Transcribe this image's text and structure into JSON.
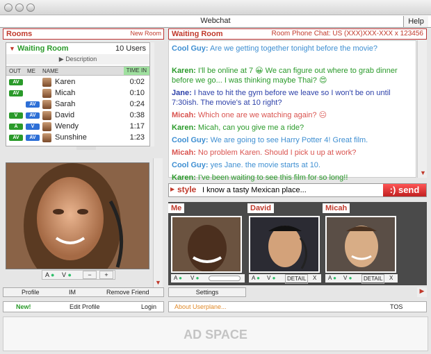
{
  "app": {
    "title": "Webchat",
    "help": "Help"
  },
  "rooms": {
    "title": "Rooms",
    "new_room": "New Room"
  },
  "waiting_room": {
    "title": "Waiting Room",
    "count": "10 Users",
    "description": "Description",
    "columns": {
      "out": "OUT",
      "me": "ME",
      "name": "NAME",
      "time": "TIME IN"
    },
    "users": [
      {
        "name": "Karen",
        "time": "0:02",
        "out": "AV",
        "me": ""
      },
      {
        "name": "Micah",
        "time": "0:10",
        "out": "AV",
        "me": ""
      },
      {
        "name": "Sarah",
        "time": "0:24",
        "out": "",
        "me": "AV"
      },
      {
        "name": "David",
        "time": "0:38",
        "out": "V",
        "me": "AV"
      },
      {
        "name": "Wendy",
        "time": "1:17",
        "out": "A",
        "me": "V"
      },
      {
        "name": "Sunshine",
        "time": "1:23",
        "out": "AV",
        "me": "AV"
      }
    ]
  },
  "profile_bar": {
    "profile": "Profile",
    "im": "IM",
    "remove": "Remove Friend"
  },
  "my_video": {
    "a": "A",
    "v": "V",
    "minus": "−",
    "plus": "+"
  },
  "chat": {
    "room": "Waiting Room",
    "phone": "Room Phone Chat: US (XXX)XXX-XXX x 123456",
    "messages": [
      {
        "speaker": "Cool Guy:",
        "text": "Are we getting together tonight before the movie?",
        "color": "#3f8fd2"
      },
      {
        "speaker": "Karen:",
        "text": "I'll be online at 7 😀 We can figure out where to grab dinner before we go... I was thinking maybe Thai? 😍",
        "color": "#2a9a2a"
      },
      {
        "speaker": "Jane:",
        "text": "I have to hit the gym before we leave so I won't be on until 7:30ish. The movie's at 10 right?",
        "color": "#2b3fa8"
      },
      {
        "speaker": "Micah:",
        "text": "Which one are we watching again? 😐",
        "color": "#d9534f"
      },
      {
        "speaker": "Karen:",
        "text": "Micah, can you give me a ride?",
        "color": "#2a9a2a"
      },
      {
        "speaker": "Cool Guy:",
        "text": "We are going to see Harry Potter 4! Great film.",
        "color": "#3f8fd2"
      },
      {
        "speaker": "Micah:",
        "text": "No problem Karen. Should I pick u up at work?",
        "color": "#d9534f"
      },
      {
        "speaker": "Cool Guy:",
        "text": "yes Jane. the movie starts at 10.",
        "color": "#3f8fd2"
      },
      {
        "speaker": "Karen:",
        "text": "I've been waiting to see this film for so long!!",
        "color": "#2a9a2a"
      }
    ],
    "style": "style",
    "input_value": "I know a tasty Mexican place...",
    "send": "send",
    "send_emoticon": ":)"
  },
  "videos": {
    "me": "Me",
    "david": "David",
    "micah": "Micah",
    "a": "A",
    "v": "V",
    "detail": "DETAIL",
    "close": "X"
  },
  "settings": "Settings",
  "footer": {
    "new": "New!",
    "edit_profile": "Edit Profile",
    "login": "Login",
    "about": "About Userplane...",
    "tos": "TOS"
  },
  "ad_space": "AD SPACE",
  "colors": {
    "accent": "#c0392b",
    "green": "#2a9a2a",
    "blue": "#3f8fd2"
  }
}
